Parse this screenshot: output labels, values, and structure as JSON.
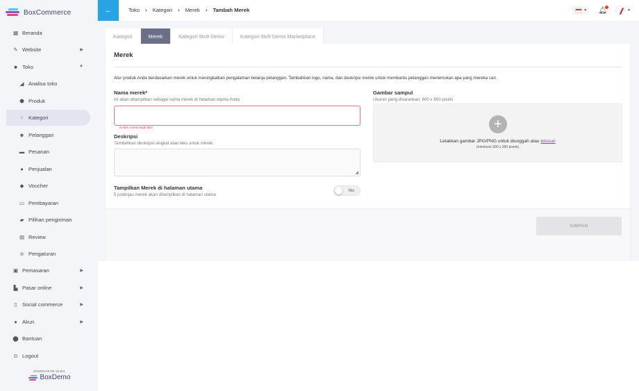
{
  "brand": {
    "logo_text": "BoxCommerce",
    "powered_by": "DISEDIAKAN OLEH",
    "powered_brand": "BoxDemo"
  },
  "sidebar": {
    "items": [
      {
        "label": "Beranda",
        "icon": "grid-icon"
      },
      {
        "label": "Website",
        "icon": "brush-icon",
        "expandable": true
      },
      {
        "label": "Toko",
        "icon": "bag-icon",
        "expanded": true
      },
      {
        "label": "Analisa toko",
        "icon": "chart-icon",
        "sub": true
      },
      {
        "label": "Produk",
        "icon": "box-icon",
        "sub": true
      },
      {
        "label": "Kategori",
        "icon": "category-icon",
        "sub": true,
        "active": true
      },
      {
        "label": "Pelanggan",
        "icon": "users-icon",
        "sub": true
      },
      {
        "label": "Pesanan",
        "icon": "orders-icon",
        "sub": true
      },
      {
        "label": "Penjualan",
        "icon": "sales-icon",
        "sub": true
      },
      {
        "label": "Voucher",
        "icon": "tag-icon",
        "sub": true
      },
      {
        "label": "Pembayaran",
        "icon": "card-icon",
        "sub": true
      },
      {
        "label": "Pilihan pengiriman",
        "icon": "truck-icon",
        "sub": true
      },
      {
        "label": "Review",
        "icon": "review-icon",
        "sub": true
      },
      {
        "label": "Pengaturan",
        "icon": "sliders-icon",
        "sub": true
      },
      {
        "label": "Pemasaran",
        "icon": "megaphone-icon",
        "expandable": true
      },
      {
        "label": "Pasar online",
        "icon": "store-icon",
        "expandable": true
      },
      {
        "label": "Social commerce",
        "icon": "social-icon",
        "expandable": true
      },
      {
        "label": "Akun",
        "icon": "user-icon",
        "expandable": true
      },
      {
        "label": "Bantuan",
        "icon": "help-icon"
      },
      {
        "label": "Logout",
        "icon": "logout-icon"
      }
    ]
  },
  "breadcrumb": [
    "Toko",
    "Kategori",
    "Merek",
    "Tambah Merek"
  ],
  "tabs": [
    {
      "label": "Kategori",
      "active": false
    },
    {
      "label": "Merek",
      "active": true
    },
    {
      "label": "Kategori 9to9 Demo",
      "active": false
    },
    {
      "label": "Kategori 9to9 Demo Marketplace",
      "active": false
    }
  ],
  "form": {
    "title": "Merek",
    "intro": "Atur produk Anda berdasarkan merek untuk meningkatkan pengalaman belanja pelanggan. Tambahkan logo, nama, dan deskripsi merek untuk membantu pelanggan menemukan apa yang mereka cari.",
    "name_label": "Nama merek*",
    "name_hint": "Ini akan ditampilkan sebagai nama merek di halaman utama Anda",
    "name_value": "",
    "name_error": "Kolom nama wajib diisi",
    "desc_label": "Deskripsi",
    "desc_hint": "Tambahkan deskripsi singkat atau teks untuk merek.",
    "desc_value": "",
    "show_label": "Tampilkan Merek di halaman utama",
    "show_hint": "5 pratinjau merek akan ditampilkan di halaman utama",
    "toggle_text": "No",
    "cover_label": "Gambar sampul",
    "cover_hint": "Ukuran yang disarankan: 600 x 600 pixels",
    "drop_text": "Letakkan gambar JPG/PNG untuk diunggah atau",
    "drop_link": "telusuri",
    "drop_min": "(minimum 300 x 300 pixels)",
    "save_label": "SIMPAN"
  },
  "colors": {
    "accent": "#29a3e4",
    "active_tab": "#6b6f87",
    "error": "#e57373",
    "link": "#8e44ad"
  }
}
